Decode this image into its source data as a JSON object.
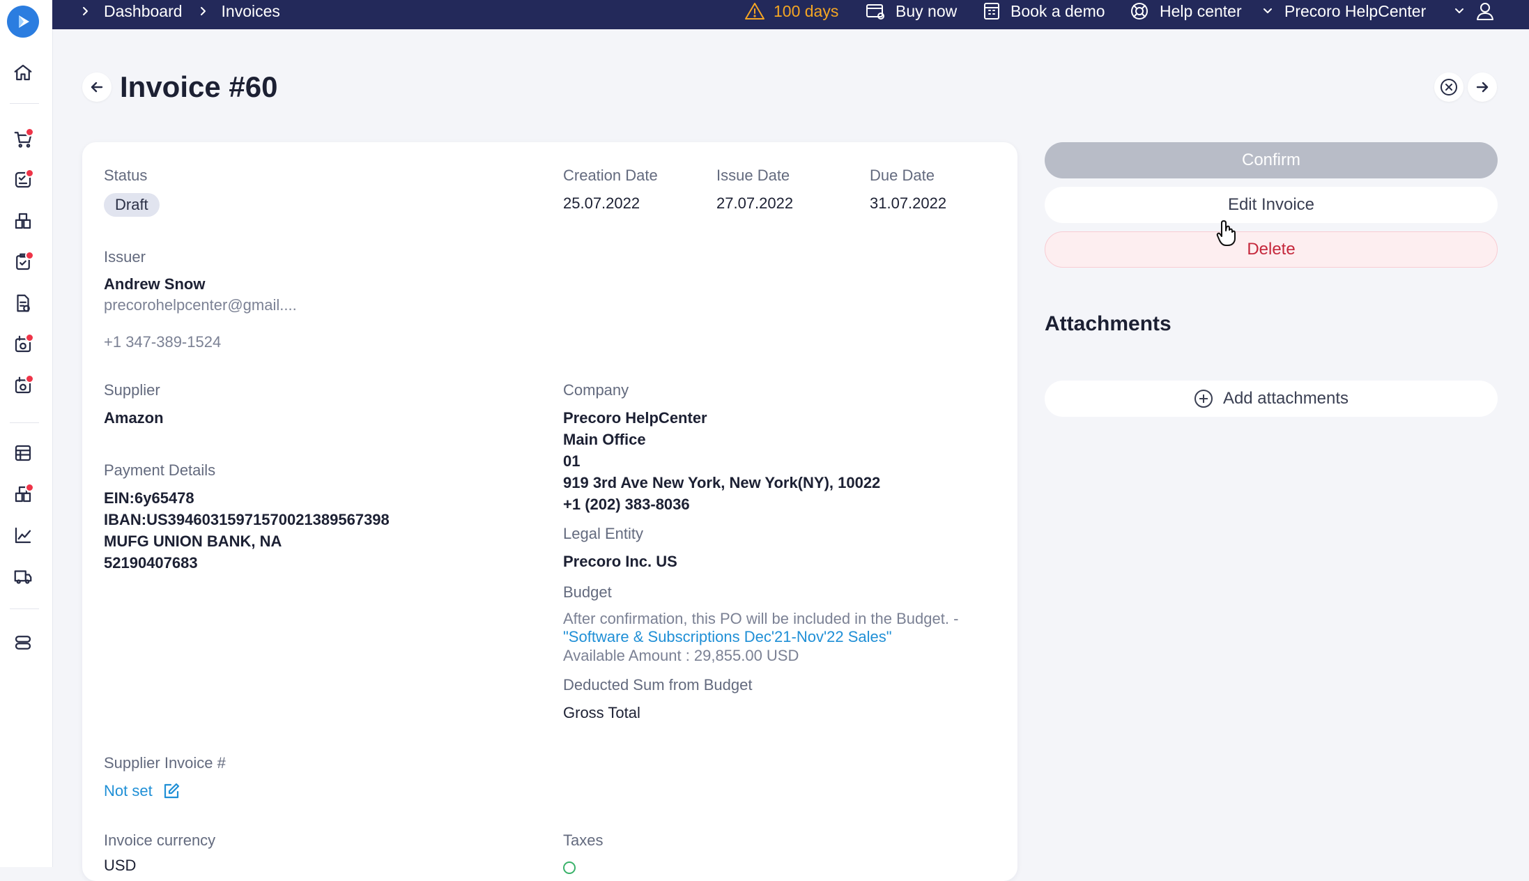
{
  "topbar": {
    "breadcrumb": [
      "Dashboard",
      "Invoices"
    ],
    "trial_days": "100 days",
    "buy_now": "Buy now",
    "book_demo": "Book a demo",
    "help_center": "Help center",
    "company": "Precoro HelpCenter"
  },
  "sidebar": {
    "items": [
      "home-icon",
      "cart-icon",
      "approvals-icon",
      "warehouse-icon",
      "receipt-check-icon",
      "document-icon",
      "invoice-icon",
      "payment-icon",
      "budget-icon",
      "catalog-icon",
      "analytics-icon",
      "delivery-icon",
      "settings-icon"
    ]
  },
  "header": {
    "title": "Invoice #60"
  },
  "details": {
    "status_label": "Status",
    "status_value": "Draft",
    "creation_date_label": "Creation Date",
    "creation_date": "25.07.2022",
    "issue_date_label": "Issue Date",
    "issue_date": "27.07.2022",
    "due_date_label": "Due Date",
    "due_date": "31.07.2022",
    "issuer_label": "Issuer",
    "issuer_name": "Andrew Snow",
    "issuer_email": "precorohelpcenter@gmail....",
    "issuer_phone": "+1 347-389-1524",
    "supplier_label": "Supplier",
    "supplier_name": "Amazon",
    "company_label": "Company",
    "company_lines": [
      "Precoro HelpCenter",
      "Main Office",
      "01",
      "919 3rd Ave New York, New York(NY), 10022",
      "+1 (202) 383-8036"
    ],
    "payment_label": "Payment Details",
    "payment_lines": [
      "EIN:6y65478",
      "IBAN:US39460315971570021389567398",
      "MUFG UNION BANK, NA",
      "52190407683"
    ],
    "legal_entity_label": "Legal Entity",
    "legal_entity": "Precoro Inc. US",
    "budget_label": "Budget",
    "budget_note": "After confirmation, this PO will be included in the Budget. -",
    "budget_link": "\"Software & Subscriptions Dec'21-Nov'22 Sales\"",
    "budget_available": "Available Amount : 29,855.00 USD",
    "deducted_label": "Deducted Sum from Budget",
    "deducted_value": "Gross Total",
    "supplier_invoice_label": "Supplier Invoice #",
    "supplier_invoice_value": "Not set",
    "currency_label": "Invoice currency",
    "currency_value": "USD",
    "taxes_label": "Taxes"
  },
  "actions": {
    "confirm": "Confirm",
    "edit": "Edit Invoice",
    "delete": "Delete"
  },
  "attachments": {
    "title": "Attachments",
    "add": "Add attachments"
  },
  "colors": {
    "topbar": "#23295a",
    "link": "#1f8fd6",
    "warning": "#f5a623",
    "delete": "#c5283c",
    "badge_dot": "#ee3448"
  }
}
